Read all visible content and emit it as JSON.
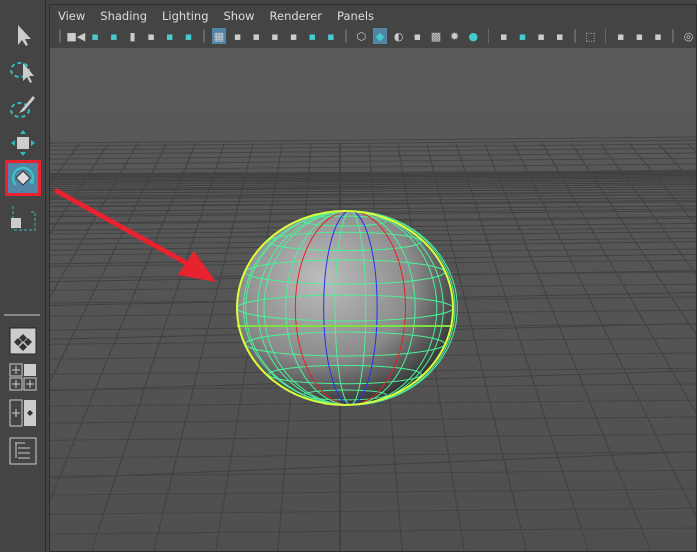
{
  "menu": [
    "View",
    "Shading",
    "Lighting",
    "Show",
    "Renderer",
    "Panels"
  ],
  "toolbox": [
    "select-tool",
    "lasso-tool",
    "paint-select-tool",
    "move-tool",
    "rotate-tool",
    "scale-tool"
  ],
  "active_tool": "rotate-tool",
  "layout_buttons": [
    "single-view-layout",
    "four-view-layout",
    "two-view-layout",
    "outliner-layout"
  ],
  "icon_groups": [
    [
      "camera",
      "lock-camera",
      "camera-attributes",
      "bookmark",
      "image-plane",
      "2d-pan-zoom",
      "grease-pencil"
    ],
    [
      "grid",
      "film-gate",
      "resolution-gate",
      "gate-mask",
      "field-chart",
      "safe-action",
      "safe-title"
    ],
    [
      "wireframe",
      "smooth-shade",
      "default-material",
      "wireframe-on-shaded",
      "xray",
      "use-all-lights",
      "shadows"
    ],
    [
      "screen-space-ao",
      "motion-blur",
      "anti-aliasing",
      "depth-of-field"
    ],
    [
      "isolate-select"
    ],
    [
      "xray-joints",
      "xray-active",
      "ambient-occlusion"
    ],
    [
      "color-management"
    ]
  ],
  "active_icons": [
    "grid",
    "smooth-shade"
  ],
  "colors": {
    "highlight": "#e8222f",
    "active": "#5285a6",
    "wire": "#4df09a",
    "outline": "#d8ff3a"
  }
}
